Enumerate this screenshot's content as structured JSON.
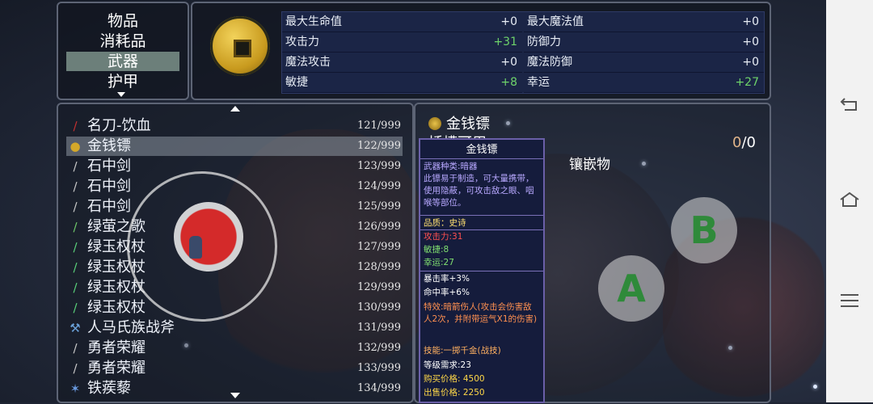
{
  "categories": {
    "items": [
      "物品",
      "消耗品",
      "武器",
      "护甲"
    ],
    "selected_index": 2
  },
  "stats": [
    {
      "name": "最大生命值",
      "value": "+0"
    },
    {
      "name": "最大魔法值",
      "value": "+0"
    },
    {
      "name": "攻击力",
      "value": "+31"
    },
    {
      "name": "防御力",
      "value": "+0"
    },
    {
      "name": "魔法攻击",
      "value": "+0"
    },
    {
      "name": "魔法防御",
      "value": "+0"
    },
    {
      "name": "敏捷",
      "value": "+8"
    },
    {
      "name": "幸运",
      "value": "+27"
    }
  ],
  "inventory": [
    {
      "name": "名刀-饮血",
      "count": "121/999",
      "icon": "red-blade-icon",
      "color": "#c43030"
    },
    {
      "name": "金钱镖",
      "count": "122/999",
      "icon": "coin-dart-icon",
      "color": "#d4a82a"
    },
    {
      "name": "石中剑",
      "count": "123/999",
      "icon": "sword-icon",
      "color": "#c8c8c8"
    },
    {
      "name": "石中剑",
      "count": "124/999",
      "icon": "sword-icon",
      "color": "#c8c8c8"
    },
    {
      "name": "石中剑",
      "count": "125/999",
      "icon": "sword-icon",
      "color": "#c8c8c8"
    },
    {
      "name": "绿萤之歌",
      "count": "126/999",
      "icon": "green-sword-icon",
      "color": "#6ec86a"
    },
    {
      "name": "绿玉权杖",
      "count": "127/999",
      "icon": "green-staff-icon",
      "color": "#5ad07a"
    },
    {
      "name": "绿玉权杖",
      "count": "128/999",
      "icon": "green-staff-icon",
      "color": "#5ad07a"
    },
    {
      "name": "绿玉权杖",
      "count": "129/999",
      "icon": "green-staff-icon",
      "color": "#5ad07a"
    },
    {
      "name": "绿玉权杖",
      "count": "130/999",
      "icon": "green-staff-icon",
      "color": "#5ad07a"
    },
    {
      "name": "人马氏族战斧",
      "count": "131/999",
      "icon": "axe-icon",
      "color": "#6aa0d8"
    },
    {
      "name": "勇者荣耀",
      "count": "132/999",
      "icon": "sword-icon",
      "color": "#c8c8c8"
    },
    {
      "name": "勇者荣耀",
      "count": "133/999",
      "icon": "sword-icon",
      "color": "#c8c8c8"
    },
    {
      "name": "铁蒺藜",
      "count": "134/999",
      "icon": "caltrop-icon",
      "color": "#6a9ae0"
    }
  ],
  "inventory_selected_index": 1,
  "detail": {
    "title": "金钱镖",
    "slot_label": "插槽可用",
    "socket_used": "0",
    "socket_total": "/0",
    "inlay_label": "镶嵌物"
  },
  "tooltip": {
    "name": "金钱镖",
    "type_line": "武器种类:暗器",
    "description": "此镖易于制造，可大量携带，使用隐蔽，可攻击敌之眼、咽喉等部位。",
    "quality": "品质：史诗",
    "attack": "攻击力:31",
    "agility": "敏捷:8",
    "luck": "幸运:27",
    "crit": "暴击率+3%",
    "hit": "命中率+6%",
    "special": "特效:暗箭伤人(攻击会伤害敌人2次，并附带运气X1的伤害)",
    "skill": "技能:一掷千金(战技)",
    "level_req": "等级需求:23",
    "buy_price": "购买价格: 4500",
    "sell_price": "出售价格: 2250",
    "colors": {
      "white": "#ffffff",
      "desc": "#b8a8ff",
      "quality": "#ffe070",
      "attack": "#ff5050",
      "green": "#80e070",
      "special": "#ff9050",
      "skill": "#ffb060",
      "price": "#ffd848"
    }
  },
  "controls": {
    "button_b": "B",
    "button_a": "A"
  },
  "system_nav": {
    "back": "back-icon",
    "home": "home-icon",
    "menu": "menu-icon"
  }
}
